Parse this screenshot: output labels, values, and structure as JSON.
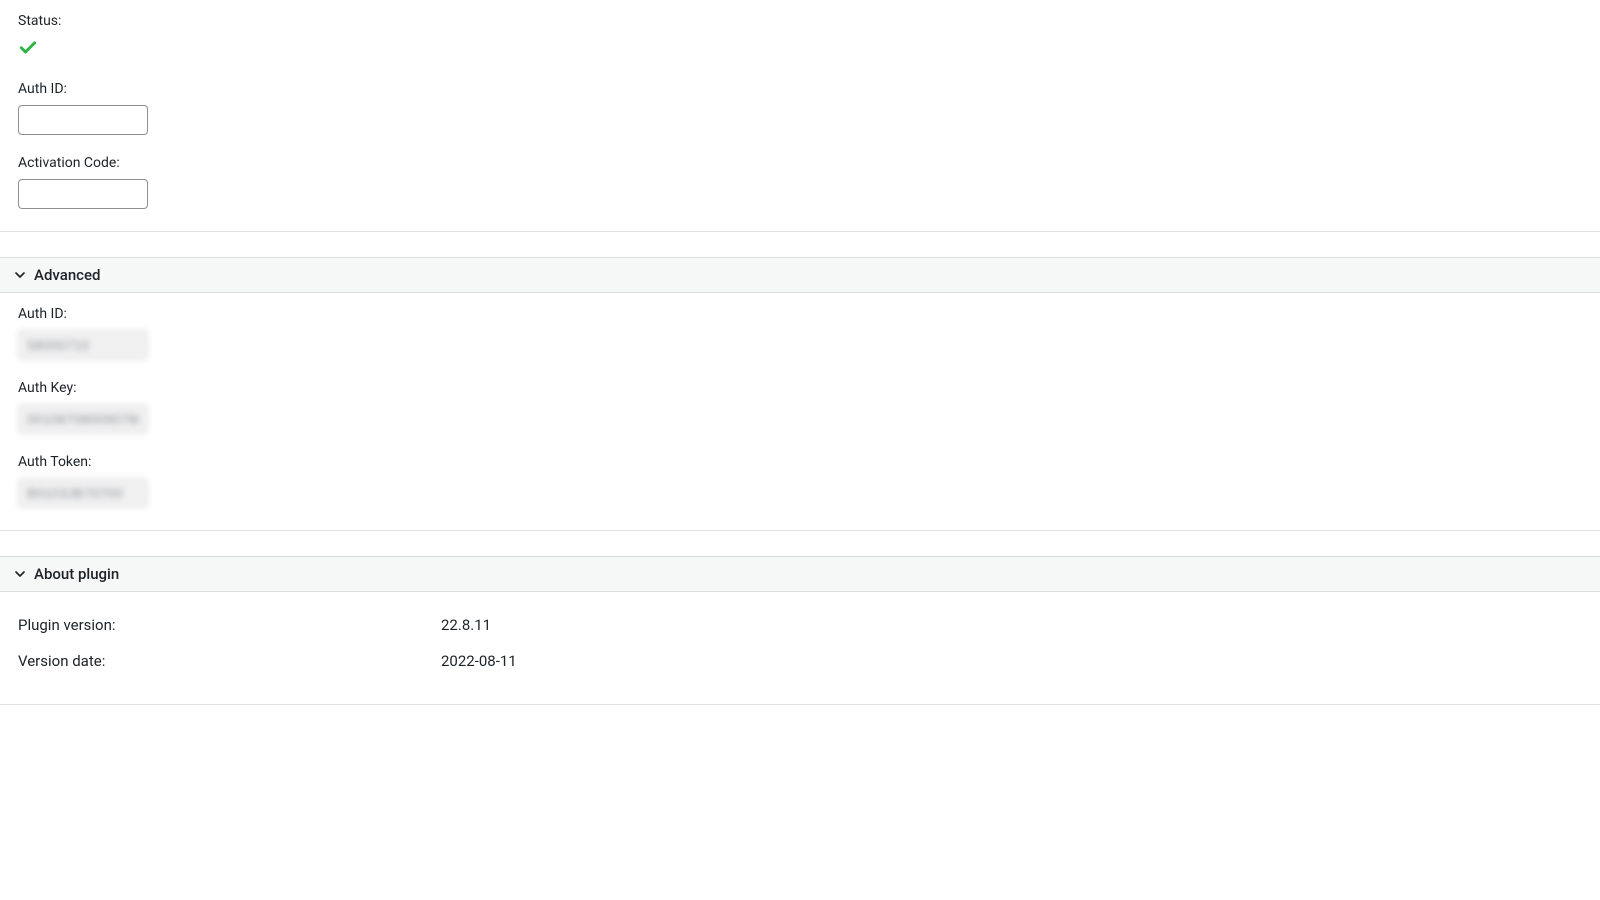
{
  "top": {
    "status_label": "Status:",
    "auth_id_label": "Auth ID:",
    "auth_id_value": "",
    "activation_code_label": "Activation Code:",
    "activation_code_value": ""
  },
  "advanced": {
    "title": "Advanced",
    "auth_id_label": "Auth ID:",
    "auth_id_value": "58000710",
    "auth_key_label": "Auth Key:",
    "auth_key_value": "001087080090780",
    "auth_token_label": "Auth Token:",
    "auth_token_value": "B0103JB70700"
  },
  "about": {
    "title": "About plugin",
    "plugin_version_label": "Plugin version:",
    "plugin_version_value": "22.8.11",
    "version_date_label": "Version date:",
    "version_date_value": "2022-08-11"
  },
  "colors": {
    "success": "#2fb344"
  }
}
